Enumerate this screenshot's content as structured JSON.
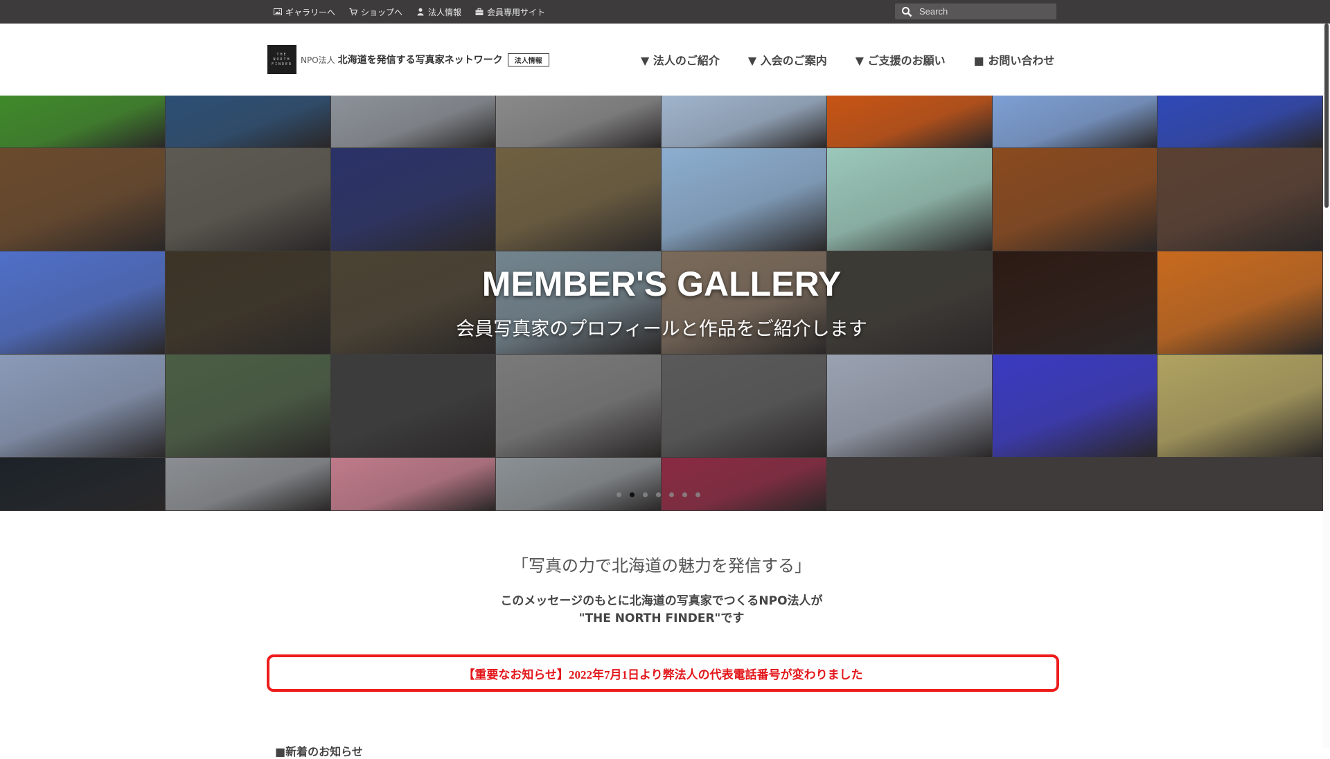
{
  "topbar": {
    "links": [
      {
        "label": "ギャラリーへ",
        "icon": "image-icon"
      },
      {
        "label": "ショップへ",
        "icon": "cart-icon"
      },
      {
        "label": "法人情報",
        "icon": "user-icon"
      },
      {
        "label": "会員専用サイト",
        "icon": "briefcase-icon"
      }
    ],
    "search_placeholder": "Search"
  },
  "header": {
    "logo_box": [
      "THE",
      "NORTH",
      "FINDER"
    ],
    "logo_npo": "NPO法人",
    "logo_name": "北海道を発信する写真家ネットワーク",
    "logo_badge": "法人情報",
    "nav": [
      "▼ 法人のご紹介",
      "▼ 入会のご案内",
      "▼ ご支援のお願い",
      "■ お問い合わせ"
    ]
  },
  "hero": {
    "title": "MEMBER'S GALLERY",
    "subtitle": "会員写真家のプロフィールと作品をご紹介します",
    "slide_count": 7,
    "active_slide": 1
  },
  "gallery": {
    "rows": [
      [
        "#3f8a2a",
        "#2c4f74",
        "#8c9299",
        "#8a8a8a",
        "#9fb4cc",
        "#c85414",
        "#7d9fd4",
        "#2f49b8"
      ],
      [
        "#6b4a2c",
        "#5d5a52",
        "#2a3268",
        "#6f6040",
        "#8caed0",
        "#9ac8ba",
        "#8a4a1e",
        "#5a4032"
      ],
      [
        "#4f6fc8",
        "#3c3426",
        "#4a4232",
        "#72848e",
        "#7a6a5a",
        "#3c3a34",
        "#2c1a14",
        "#c86a1e"
      ],
      [
        "#8a9ab8",
        "#4a5e44",
        "#3c3c3c",
        "#7a7a7a",
        "#5a5a5a",
        "#9aa2b2",
        "#3a3ac2",
        "#b0a260"
      ],
      [
        "#1c2228",
        "#8a8e92",
        "#c07a8a",
        "#8a9094",
        "#8a2a42"
      ]
    ]
  },
  "content": {
    "tagline": "「写真の力で北海道の魅力を発信する」",
    "intro_line1": "このメッセージのもとに北海道の写真家でつくるNPO法人が",
    "intro_line2": "\"THE NORTH FINDER\"です",
    "notice": "【重要なお知らせ】2022年7月1日より弊法人の代表電話番号が変わりました",
    "next_heading": "■新着のお知らせ"
  }
}
